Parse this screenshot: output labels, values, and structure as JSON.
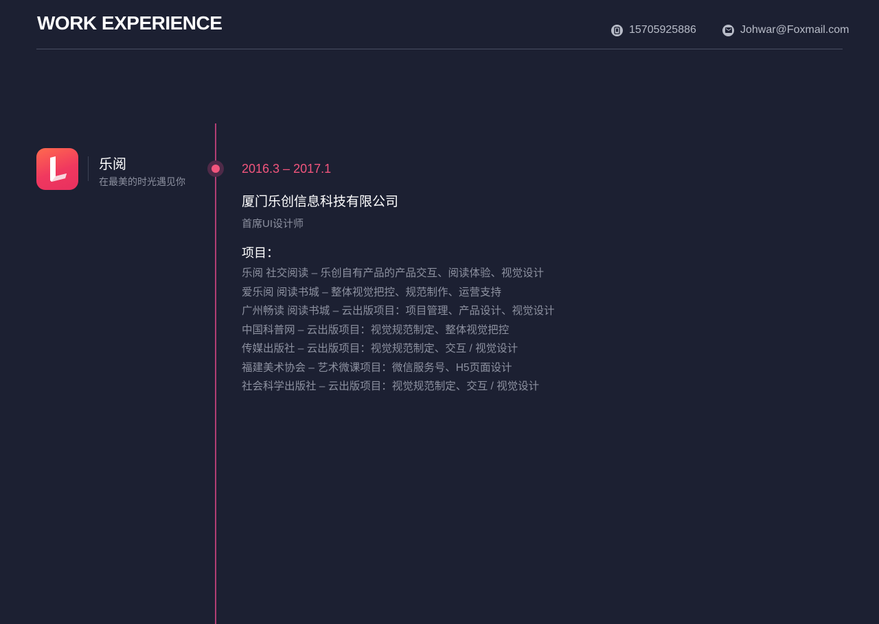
{
  "header": {
    "title": "WORK EXPERIENCE",
    "phone": "15705925886",
    "email": "Johwar@Foxmail.com",
    "phone_icon": "phone-icon",
    "email_icon": "mail-icon"
  },
  "app": {
    "name": "乐阅",
    "slogan": "在最美的时光遇见你",
    "icon": "book-l-logo-icon"
  },
  "experience": {
    "period": "2016.3 – 2017.1",
    "company": "厦门乐创信息科技有限公司",
    "role": "首席UI设计师",
    "projects_heading": "项目：",
    "projects": [
      "乐阅 社交阅读 – 乐创自有产品的产品交互、阅读体验、视觉设计",
      "爱乐阅 阅读书城 – 整体视觉把控、规范制作、运营支持",
      "广州畅读 阅读书城 – 云出版项目：项目管理、产品设计、视觉设计",
      "中国科普网 – 云出版项目：视觉规范制定、整体视觉把控",
      "传媒出版社 – 云出版项目：视觉规范制定、交互 / 视觉设计",
      "福建美术协会 – 艺术微课项目：微信服务号、H5页面设计",
      "社会科学出版社 – 云出版项目：视觉规范制定、交互 / 视觉设计"
    ]
  },
  "colors": {
    "background": "#1c2032",
    "accent": "#f2557d",
    "timeline": "#b23e74",
    "muted_text": "#8d91a0"
  }
}
